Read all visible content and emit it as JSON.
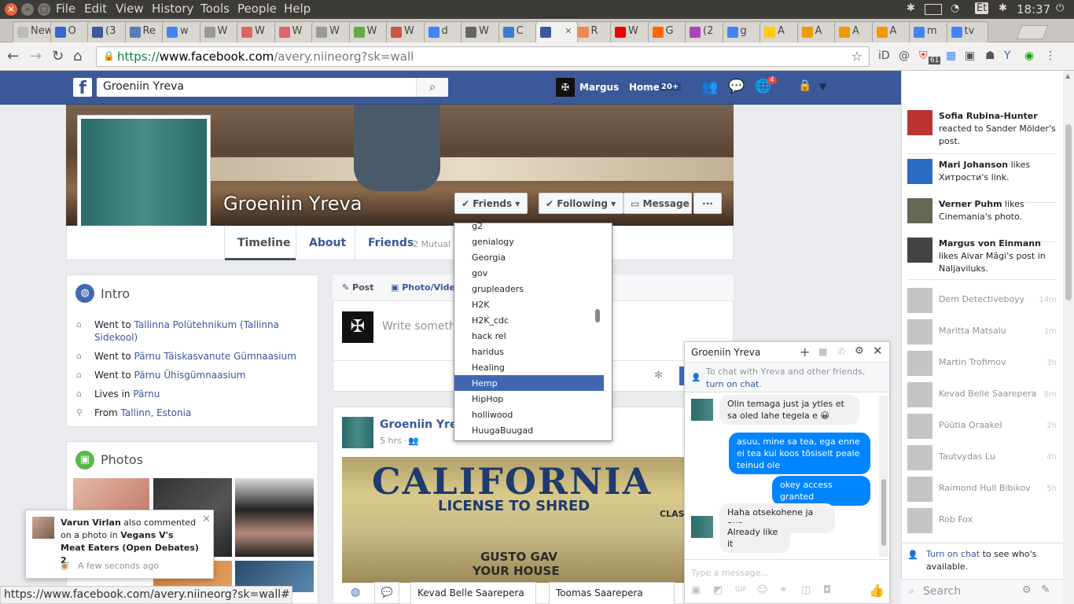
{
  "os": {
    "menu": [
      "File",
      "Edit",
      "View",
      "History",
      "Tools",
      "People",
      "Help"
    ],
    "tray": {
      "keyboard": "Et",
      "time": "18:37"
    }
  },
  "tabs": [
    {
      "label": "New",
      "color": "#bbb"
    },
    {
      "label": "O",
      "color": "#3367d6"
    },
    {
      "label": "(3",
      "color": "#3b5998"
    },
    {
      "label": "Re",
      "color": "#5a7bb5"
    },
    {
      "label": "w",
      "color": "#4285f4"
    },
    {
      "label": "W",
      "color": "#999"
    },
    {
      "label": "W",
      "color": "#d66"
    },
    {
      "label": "W",
      "color": "#d66"
    },
    {
      "label": "W",
      "color": "#999"
    },
    {
      "label": "W",
      "color": "#6a4"
    },
    {
      "label": "W",
      "color": "#c54"
    },
    {
      "label": "d",
      "color": "#4285f4"
    },
    {
      "label": "W",
      "color": "#666"
    },
    {
      "label": "C",
      "color": "#3a7bd5"
    },
    {
      "label": "",
      "color": "#3b5998",
      "active": true
    },
    {
      "label": "R",
      "color": "#e85"
    },
    {
      "label": "W",
      "color": "#e00"
    },
    {
      "label": "G",
      "color": "#f60"
    },
    {
      "label": "(2",
      "color": "#a4b"
    },
    {
      "label": "g",
      "color": "#4285f4"
    },
    {
      "label": "A",
      "color": "#fc0"
    },
    {
      "label": "A",
      "color": "#e90"
    },
    {
      "label": "A",
      "color": "#e90"
    },
    {
      "label": "A",
      "color": "#e90"
    },
    {
      "label": "m",
      "color": "#4285f4"
    },
    {
      "label": "tv",
      "color": "#4285f4"
    }
  ],
  "address": {
    "scheme": "https://",
    "host": "www.facebook.com",
    "path": "/avery.niineorg?sk=wall"
  },
  "ext_badge": "61",
  "fb": {
    "search_value": "Groeniin Yreva",
    "user": "Margus",
    "home": "Home",
    "home_count": "20+",
    "notif_count": "4"
  },
  "profile": {
    "name": "Groeniin Yreva",
    "buttons": {
      "friends": "Friends",
      "following": "Following",
      "message": "Message",
      "more": "···"
    },
    "nav": {
      "timeline": "Timeline",
      "about": "About",
      "friends": "Friends",
      "friends_mutual": "2 Mutual"
    }
  },
  "friend_lists": [
    "g2",
    "genialogy",
    "Georgia",
    "gov",
    "grupleaders",
    "H2K",
    "H2K_cdc",
    "hack rel",
    "haridus",
    "Healing",
    "Hemp",
    "HipHop",
    "holliwood",
    "HuugaBuugad"
  ],
  "friend_lists_selected": "Hemp",
  "intro": {
    "title": "Intro",
    "rows": [
      {
        "prefix": "Went to ",
        "link": "Tallinna Polütehnikum (Tallinna Sidekool)",
        "icon": "school-icon"
      },
      {
        "prefix": "Went to ",
        "link": "Pärnu Täiskasvanute Gümnaasium",
        "icon": "school-icon"
      },
      {
        "prefix": "Went to ",
        "link": "Pärnu Ühisgümnaasium",
        "icon": "school-icon"
      },
      {
        "prefix": "Lives in ",
        "link": "Pärnu",
        "icon": "home-icon"
      },
      {
        "prefix": "From ",
        "link": "Tallinn, Estonia",
        "icon": "location-pin-icon"
      }
    ]
  },
  "photos": {
    "title": "Photos"
  },
  "composer": {
    "post_tab": "Post",
    "photo_tab": "Photo/Video",
    "placeholder": "Write something"
  },
  "post": {
    "author": "Groeniin Yreva",
    "time": "5 hrs ·",
    "image_text1": "CALIFORNIA",
    "image_text2": "LICENSE TO SHRED",
    "image_text3": "GUSTO GAV",
    "image_text4": "YOUR HOUSE",
    "image_text5": "CLAS"
  },
  "chat": {
    "title": "Groeniin Yreva",
    "notice_text": "To chat with Yreva and other friends,",
    "notice_link": "turn on chat",
    "notice_dot": ".",
    "messages": [
      {
        "dir": "in",
        "text": "Olin temaga just ja ytles et sa oled lahe tegela e 😀"
      },
      {
        "dir": "out",
        "text": "asuu, mine sa tea, ega enne ei tea kui koos tõsiselt peale teinud ole"
      },
      {
        "dir": "out",
        "text": "okey access granted"
      },
      {
        "dir": "in",
        "text": "Haha otsekohene ja aus"
      },
      {
        "dir": "in",
        "text": "Already like it"
      }
    ],
    "input_placeholder": "Type a message..."
  },
  "ticker": [
    {
      "name": "Sofia Rubina-Hunter",
      "rest": " reacted to Sander Mölder's post.",
      "color": "#b33"
    },
    {
      "name": "Mari Johanson",
      "rest": " likes Хитрости's link.",
      "color": "#2a6bc4"
    },
    {
      "name": "Verner Puhm",
      "rest": " likes Cinemania's photo.",
      "color": "#665"
    },
    {
      "name": "Margus von Einmann",
      "rest": " likes Aivar Mägi's post in Naljaviluks.",
      "color": "#444"
    }
  ],
  "chat_list": [
    {
      "name": "Dem Detectiveboyy",
      "time": "14m"
    },
    {
      "name": "Maritta Matsalu",
      "time": "1m"
    },
    {
      "name": "Martin Trofimov",
      "time": "3h"
    },
    {
      "name": "Kevad Belle Saarepera",
      "time": "8m"
    },
    {
      "name": "Püütia Oraakel",
      "time": "2h"
    },
    {
      "name": "Tautvydas Lu",
      "time": "4h"
    },
    {
      "name": "Raimond Hull Bibikov",
      "time": "5h"
    },
    {
      "name": "Rob Fox",
      "time": ""
    }
  ],
  "sidebar_footer": {
    "link": "Turn on chat",
    "rest": " to see who's available.",
    "search": "Search"
  },
  "notification": {
    "name": "Varun Virlan",
    "text1": " also commented on a photo in ",
    "group": "Vegans V's Meat Eaters (Open Debates) 2",
    "text2": ".",
    "time": "A few seconds ago"
  },
  "status_url": "https://www.facebook.com/avery.niineorg?sk=wall#",
  "dock": [
    "Kevad Belle Saarepera",
    "Toomas Saarepera"
  ]
}
